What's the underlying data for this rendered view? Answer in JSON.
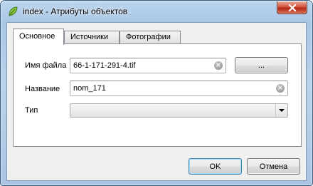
{
  "window": {
    "title": "index - Атрибуты объектов",
    "close_glyph": "✕"
  },
  "tabs": [
    {
      "label": "Основное",
      "active": true
    },
    {
      "label": "Источники",
      "active": false
    },
    {
      "label": "Фотографии",
      "active": false
    }
  ],
  "form": {
    "filename": {
      "label": "Имя файла",
      "value": "66-1-171-291-4.tif"
    },
    "browse_label": "...",
    "name": {
      "label": "Название",
      "value": "nom_171"
    },
    "type": {
      "label": "Тип",
      "value": ""
    }
  },
  "buttons": {
    "ok": "OK",
    "cancel": "Отмена"
  },
  "icons": {
    "app": "qgis-leaf-icon",
    "clear": "clear-field-icon",
    "close": "close-icon",
    "dropdown": "chevron-down-icon"
  },
  "colors": {
    "titlebar": "#a9c6e6",
    "close_button": "#c8412b",
    "dialog_background": "#f0f0f0",
    "default_button_border": "#3c7fb1"
  }
}
